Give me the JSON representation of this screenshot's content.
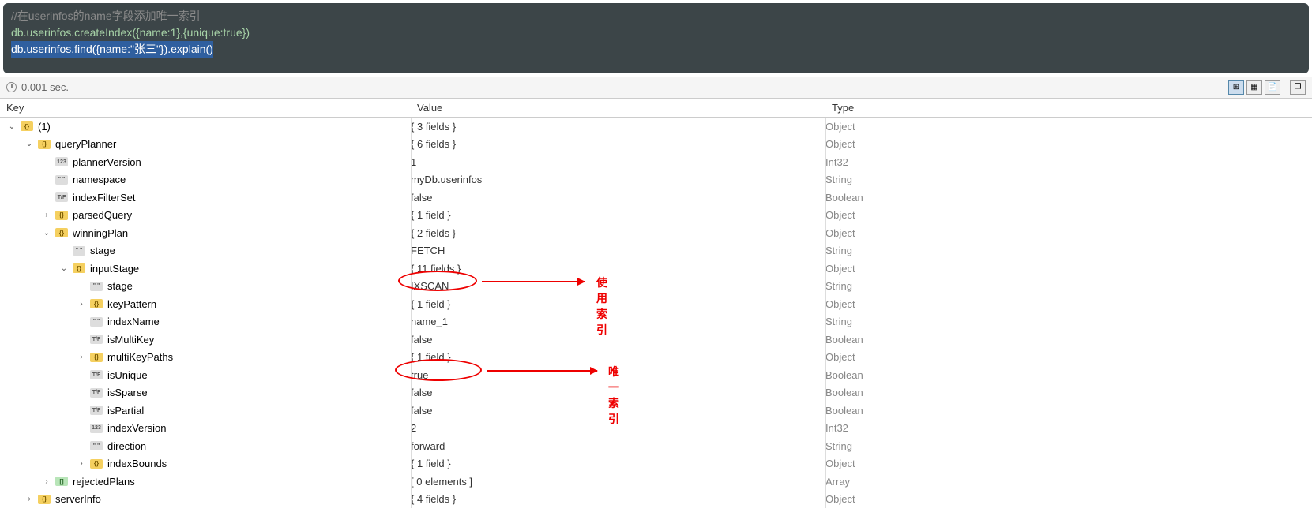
{
  "editor": {
    "comment": "//在userinfos的name字段添加唯一索引",
    "line1": "db.userinfos.createIndex({name:1},{unique:true})",
    "line2": "db.userinfos.find({name:\"张三\"}).explain()"
  },
  "status": {
    "time": "0.001 sec."
  },
  "headers": {
    "key": "Key",
    "value": "Value",
    "type": "Type"
  },
  "rows": [
    {
      "indent": 0,
      "toggle": "open",
      "icon": "obj",
      "key": "(1)",
      "value": "{ 3 fields }",
      "type": "Object",
      "gray": true
    },
    {
      "indent": 1,
      "toggle": "open",
      "icon": "obj",
      "key": "queryPlanner",
      "value": "{ 6 fields }",
      "type": "Object",
      "gray": true
    },
    {
      "indent": 2,
      "toggle": "none",
      "icon": "int",
      "key": "plannerVersion",
      "value": "1",
      "type": "Int32"
    },
    {
      "indent": 2,
      "toggle": "none",
      "icon": "str",
      "key": "namespace",
      "value": "myDb.userinfos",
      "type": "String"
    },
    {
      "indent": 2,
      "toggle": "none",
      "icon": "bool",
      "key": "indexFilterSet",
      "value": "false",
      "type": "Boolean"
    },
    {
      "indent": 2,
      "toggle": "closed",
      "icon": "obj",
      "key": "parsedQuery",
      "value": "{ 1 field }",
      "type": "Object",
      "gray": true
    },
    {
      "indent": 2,
      "toggle": "open",
      "icon": "obj",
      "key": "winningPlan",
      "value": "{ 2 fields }",
      "type": "Object",
      "gray": true
    },
    {
      "indent": 3,
      "toggle": "none",
      "icon": "str",
      "key": "stage",
      "value": "FETCH",
      "type": "String"
    },
    {
      "indent": 3,
      "toggle": "open",
      "icon": "obj",
      "key": "inputStage",
      "value": "{ 11 fields }",
      "type": "Object",
      "gray": true
    },
    {
      "indent": 4,
      "toggle": "none",
      "icon": "str",
      "key": "stage",
      "value": "IXSCAN",
      "type": "String"
    },
    {
      "indent": 4,
      "toggle": "closed",
      "icon": "obj",
      "key": "keyPattern",
      "value": "{ 1 field }",
      "type": "Object",
      "gray": true
    },
    {
      "indent": 4,
      "toggle": "none",
      "icon": "str",
      "key": "indexName",
      "value": "name_1",
      "type": "String"
    },
    {
      "indent": 4,
      "toggle": "none",
      "icon": "bool",
      "key": "isMultiKey",
      "value": "false",
      "type": "Boolean"
    },
    {
      "indent": 4,
      "toggle": "closed",
      "icon": "obj",
      "key": "multiKeyPaths",
      "value": "{ 1 field }",
      "type": "Object",
      "gray": true
    },
    {
      "indent": 4,
      "toggle": "none",
      "icon": "bool",
      "key": "isUnique",
      "value": "true",
      "type": "Boolean"
    },
    {
      "indent": 4,
      "toggle": "none",
      "icon": "bool",
      "key": "isSparse",
      "value": "false",
      "type": "Boolean"
    },
    {
      "indent": 4,
      "toggle": "none",
      "icon": "bool",
      "key": "isPartial",
      "value": "false",
      "type": "Boolean"
    },
    {
      "indent": 4,
      "toggle": "none",
      "icon": "int",
      "key": "indexVersion",
      "value": "2",
      "type": "Int32"
    },
    {
      "indent": 4,
      "toggle": "none",
      "icon": "str",
      "key": "direction",
      "value": "forward",
      "type": "String"
    },
    {
      "indent": 4,
      "toggle": "closed",
      "icon": "obj",
      "key": "indexBounds",
      "value": "{ 1 field }",
      "type": "Object",
      "gray": true
    },
    {
      "indent": 2,
      "toggle": "closed",
      "icon": "arr",
      "key": "rejectedPlans",
      "value": "[ 0 elements ]",
      "type": "Array",
      "gray": true
    },
    {
      "indent": 1,
      "toggle": "closed",
      "icon": "obj",
      "key": "serverInfo",
      "value": "{ 4 fields }",
      "type": "Object",
      "gray": true
    }
  ],
  "annotations": {
    "a1": "使用索引",
    "a2": "唯一索引"
  }
}
